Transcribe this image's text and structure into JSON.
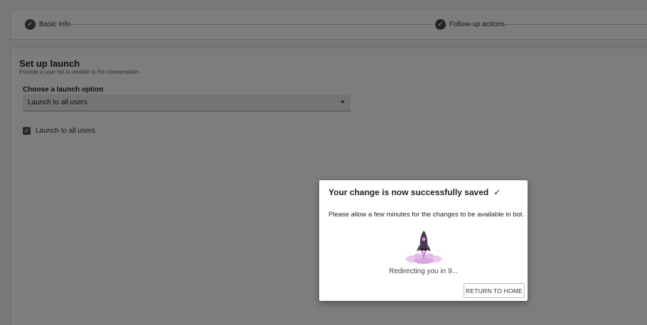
{
  "stepper": {
    "steps": [
      {
        "label": "Basic Info",
        "icon": "check-icon",
        "completed": true
      },
      {
        "label": "Follow-up actions",
        "icon": "check-icon",
        "completed": true
      }
    ]
  },
  "launch": {
    "title": "Set up launch",
    "subtitle": "Provide a user list to enable to the conversation",
    "option_label": "Choose a launch option",
    "selected_option": "Launch to all users",
    "checkbox_label": "Launch to all users",
    "checkbox_checked": true
  },
  "modal": {
    "title": "Your change is now successfully saved",
    "title_icon": "checkmark-icon",
    "body": "Please allow a few minutes for the changes to be available in bot.",
    "illustration": "rocket-launch-icon",
    "redirect_text": "Redirecting you in 9...",
    "return_button": "RETURN TO HOME"
  },
  "colors": {
    "overlay": "#000000",
    "rocket_body": "#4a3a4f",
    "rocket_flame": "#c86fd0",
    "smoke": "#e3b8e8"
  }
}
